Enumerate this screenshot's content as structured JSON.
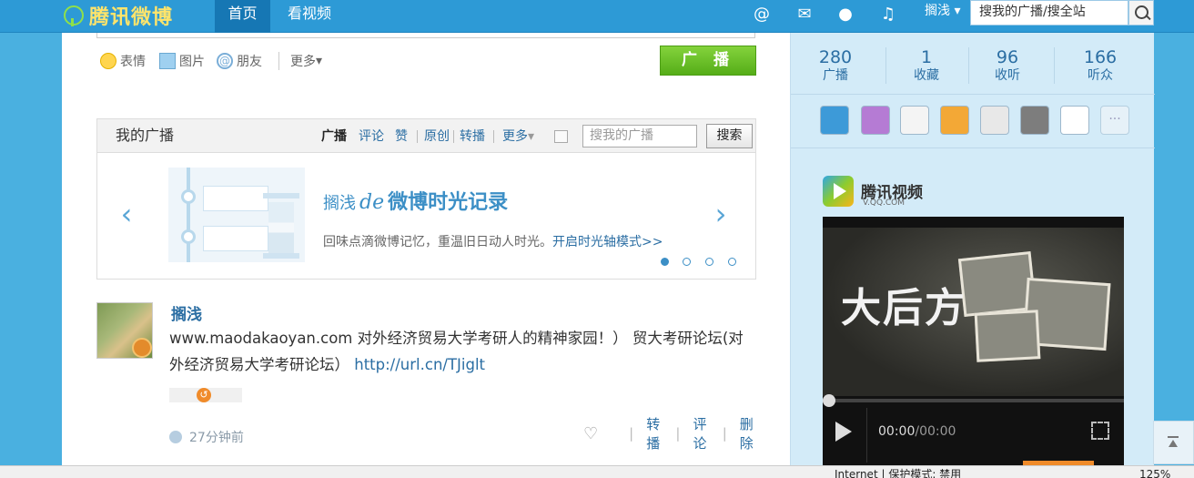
{
  "topbar": {
    "logo_text": "腾讯微博",
    "nav": [
      "首页",
      "看视频"
    ],
    "user": "搁浅",
    "search_placeholder": "搜我的广播/搜全站",
    "icons": [
      "at-icon",
      "mail-icon",
      "user-icon",
      "sound-icon"
    ]
  },
  "composer": {
    "tools": [
      "表情",
      "图片",
      "朋友",
      "更多"
    ],
    "submit": "广 播"
  },
  "feed": {
    "title": "我的广播",
    "tabs": [
      "广播",
      "评论",
      "赞",
      "原创",
      "转播",
      "更多"
    ],
    "search_placeholder": "搜我的广播",
    "search_button": "搜索"
  },
  "banner": {
    "title_name": "搁浅",
    "title_de": "de",
    "title_main": "微博时光记录",
    "subtitle": "回味点滴微博记忆，重温旧日动人时光。",
    "link": "开启时光轴模式>>"
  },
  "post": {
    "author": "搁浅",
    "text": "www.maodakaoyan.com 对外经济贸易大学考研人的精神家园！） 贸大考研论坛(对外经济贸易大学考研论坛）",
    "link": "http://url.cn/TJiglt",
    "time": "27分钟前",
    "actions": [
      "转播",
      "评论",
      "删除"
    ]
  },
  "stats": [
    {
      "value": "280",
      "label": "广播"
    },
    {
      "value": "1",
      "label": "收藏"
    },
    {
      "value": "96",
      "label": "收听"
    },
    {
      "value": "166",
      "label": "听众"
    }
  ],
  "apps": {
    "more": "···"
  },
  "video": {
    "brand": "腾讯视频",
    "domain": "V.QQ.COM",
    "poster_title": "大后方",
    "time_current": "00:00",
    "time_total": "/00:00"
  },
  "status": {
    "zone": "Internet | 保护模式: 禁用",
    "zoom": "125%"
  }
}
